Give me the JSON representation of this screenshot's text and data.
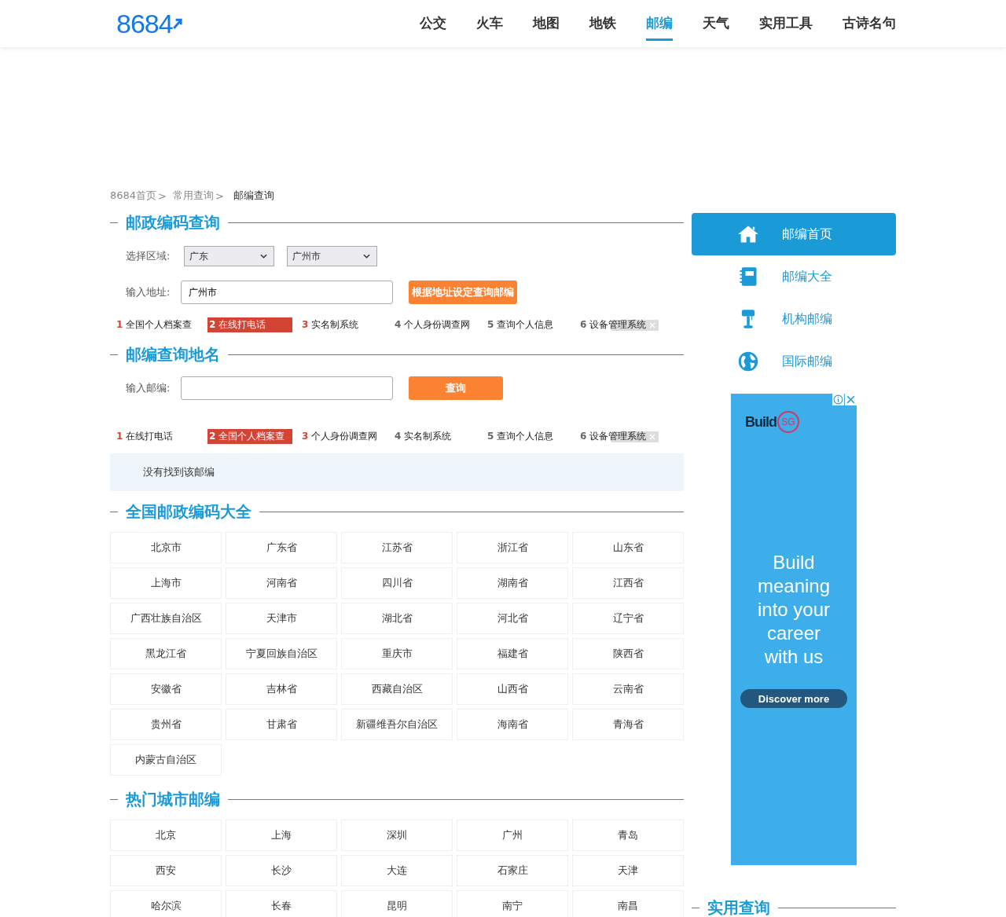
{
  "header": {
    "logo": "8684",
    "nav": [
      {
        "label": "公交",
        "selected": false
      },
      {
        "label": "火车",
        "selected": false
      },
      {
        "label": "地图",
        "selected": false
      },
      {
        "label": "地铁",
        "selected": false
      },
      {
        "label": "邮编",
        "selected": true
      },
      {
        "label": "天气",
        "selected": false
      },
      {
        "label": "实用工具",
        "selected": false
      },
      {
        "label": "古诗名句",
        "selected": false
      }
    ]
  },
  "breadcrumb": [
    {
      "label": "8684首页",
      "sep": ">"
    },
    {
      "label": "常用查询",
      "sep": ">"
    },
    {
      "label": "邮编查询"
    }
  ],
  "postcode_search": {
    "title": "邮政编码查询",
    "region_label": "选择区域:",
    "province": "广东",
    "city": "广州市",
    "address_label": "输入地址:",
    "address": "广州市",
    "button": "根据地址设定查询邮编",
    "links": [
      {
        "num": "1",
        "label": "全国个人档案查",
        "hot": true,
        "selected": false
      },
      {
        "num": "2",
        "label": "在线打电话",
        "hot": true,
        "selected": true
      },
      {
        "num": "3",
        "label": "实名制系统",
        "hot": true,
        "selected": false
      },
      {
        "num": "4",
        "label": "个人身份调查网",
        "hot": false,
        "selected": false
      },
      {
        "num": "5",
        "label": "查询个人信息",
        "hot": false,
        "selected": false
      },
      {
        "num": "6",
        "label": "设备管理系统",
        "hot": false,
        "selected": false
      }
    ]
  },
  "place_search": {
    "title": "邮编查询地名",
    "postcode_label": "输入邮编:",
    "button": "查询",
    "links": [
      {
        "num": "1",
        "label": "在线打电话",
        "hot": true,
        "selected": false
      },
      {
        "num": "2",
        "label": "全国个人档案查",
        "hot": true,
        "selected": true
      },
      {
        "num": "3",
        "label": "个人身份调查网",
        "hot": true,
        "selected": false
      },
      {
        "num": "4",
        "label": "实名制系统",
        "hot": false,
        "selected": false
      },
      {
        "num": "5",
        "label": "查询个人信息",
        "hot": false,
        "selected": false
      },
      {
        "num": "6",
        "label": "设备管理系统",
        "hot": false,
        "selected": false
      }
    ],
    "result": "没有找到该邮编"
  },
  "provinces": {
    "title": "全国邮政编码大全",
    "items": [
      "北京市",
      "广东省",
      "江苏省",
      "浙江省",
      "山东省",
      "上海市",
      "河南省",
      "四川省",
      "湖南省",
      "江西省",
      "广西壮族自治区",
      "天津市",
      "湖北省",
      "河北省",
      "辽宁省",
      "黑龙江省",
      "宁夏回族自治区",
      "重庆市",
      "福建省",
      "陕西省",
      "安徽省",
      "吉林省",
      "西藏自治区",
      "山西省",
      "云南省",
      "贵州省",
      "甘肃省",
      "新疆维吾尔自治区",
      "海南省",
      "青海省",
      "内蒙古自治区"
    ]
  },
  "hot_cities": {
    "title": "热门城市邮编",
    "items": [
      "北京",
      "上海",
      "深圳",
      "广州",
      "青岛",
      "西安",
      "长沙",
      "大连",
      "石家庄",
      "天津",
      "哈尔滨",
      "长春",
      "昆明",
      "南宁",
      "南昌"
    ]
  },
  "sidebar": {
    "menu": [
      {
        "label": "邮编首页",
        "kind": "home",
        "selected": true
      },
      {
        "label": "邮编大全",
        "kind": "book",
        "selected": false
      },
      {
        "label": "机构邮编",
        "kind": "mailbox",
        "selected": false
      },
      {
        "label": "国际邮编",
        "kind": "globe",
        "selected": false
      }
    ],
    "ad": {
      "brand": "Build",
      "brand_mark": "SG",
      "headline": "Build meaning into your career with us",
      "button": "Discover more"
    },
    "section_title": "实用查询"
  }
}
